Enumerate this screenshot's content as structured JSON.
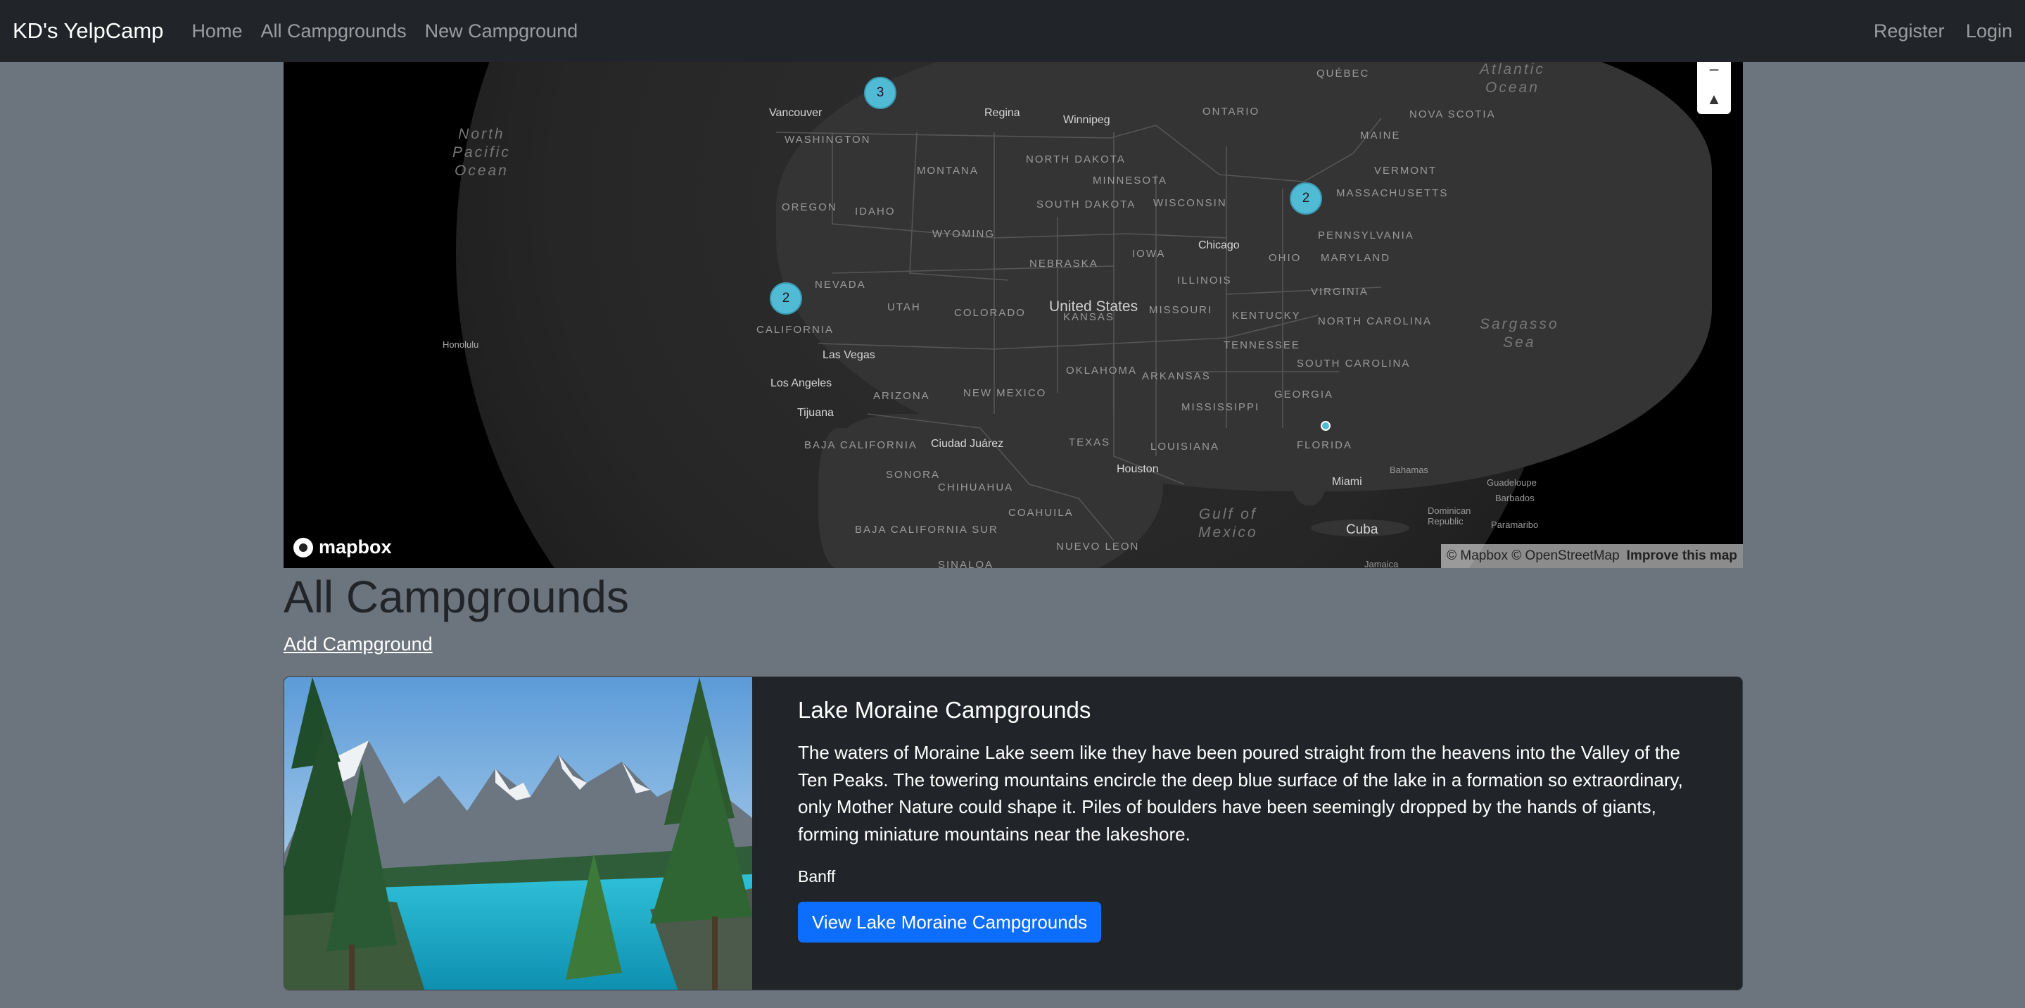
{
  "navbar": {
    "brand": "KD's YelpCamp",
    "links": [
      "Home",
      "All Campgrounds",
      "New Campground"
    ],
    "right_links": [
      "Register",
      "Login"
    ]
  },
  "map": {
    "clusters": [
      "3",
      "2",
      "2"
    ],
    "country_label": "United States",
    "oceans": [
      {
        "line1": "North",
        "line2": "Pacific",
        "line3": "Ocean"
      },
      {
        "line1": "Atlantic",
        "line2": "Ocean"
      },
      {
        "line1": "Sargasso",
        "line2": "Sea"
      },
      {
        "line1": "Gulf of",
        "line2": "Mexico"
      }
    ],
    "states": [
      "WASHINGTON",
      "OREGON",
      "CALIFORNIA",
      "NEVADA",
      "IDAHO",
      "MONTANA",
      "WYOMING",
      "UTAH",
      "ARIZONA",
      "COLORADO",
      "NEW MEXICO",
      "NORTH DAKOTA",
      "SOUTH DAKOTA",
      "NEBRASKA",
      "KANSAS",
      "OKLAHOMA",
      "TEXAS",
      "MINNESOTA",
      "IOWA",
      "MISSOURI",
      "ARKANSAS",
      "LOUISIANA",
      "WISCONSIN",
      "ILLINOIS",
      "MISSISSIPPI",
      "TENNESSEE",
      "KENTUCKY",
      "OHIO",
      "PENNSYLVANIA",
      "VIRGINIA",
      "NORTH CAROLINA",
      "SOUTH CAROLINA",
      "GEORGIA",
      "FLORIDA",
      "MARYLAND",
      "MASSACHUSETTS",
      "VERMONT",
      "MAINE",
      "NOVA SCOTIA",
      "QUÉBEC",
      "ONTARIO",
      "SONORA",
      "CHIHUAHUA",
      "COAHUILA",
      "NUEVO LEON",
      "SINALOA",
      "BAJA CALIFORNIA",
      "BAJA CALIFORNIA SUR"
    ],
    "cities": [
      "Vancouver",
      "Regina",
      "Winnipeg",
      "Chicago",
      "Las Vegas",
      "Los Angeles",
      "Tijuana",
      "Ciudad Juárez",
      "Houston",
      "Miami",
      "Cuba",
      "Bahamas",
      "Honolulu",
      "Guadeloupe",
      "Barbados",
      "Dominican Republic",
      "Paramaribo",
      "Jamaica"
    ],
    "logo_text": "mapbox",
    "attribution": "© Mapbox © OpenStreetMap",
    "improve_link": "Improve this map"
  },
  "main": {
    "title": "All Campgrounds",
    "add_link": "Add Campground"
  },
  "campgrounds": [
    {
      "title": "Lake Moraine Campgrounds",
      "description": "The waters of Moraine Lake seem like they have been poured straight from the heavens into the Valley of the Ten Peaks. The towering mountains encircle the deep blue surface of the lake in a formation so extraordinary, only Mother Nature could shape it. Piles of boulders have been seemingly dropped by the hands of giants, forming miniature mountains near the lakeshore.",
      "location": "Banff",
      "button": "View Lake Moraine Campgrounds"
    }
  ],
  "colors": {
    "navbar": "#212529",
    "page_bg": "#6c757d",
    "cluster": "#51bbd6",
    "primary": "#0d6efd"
  }
}
